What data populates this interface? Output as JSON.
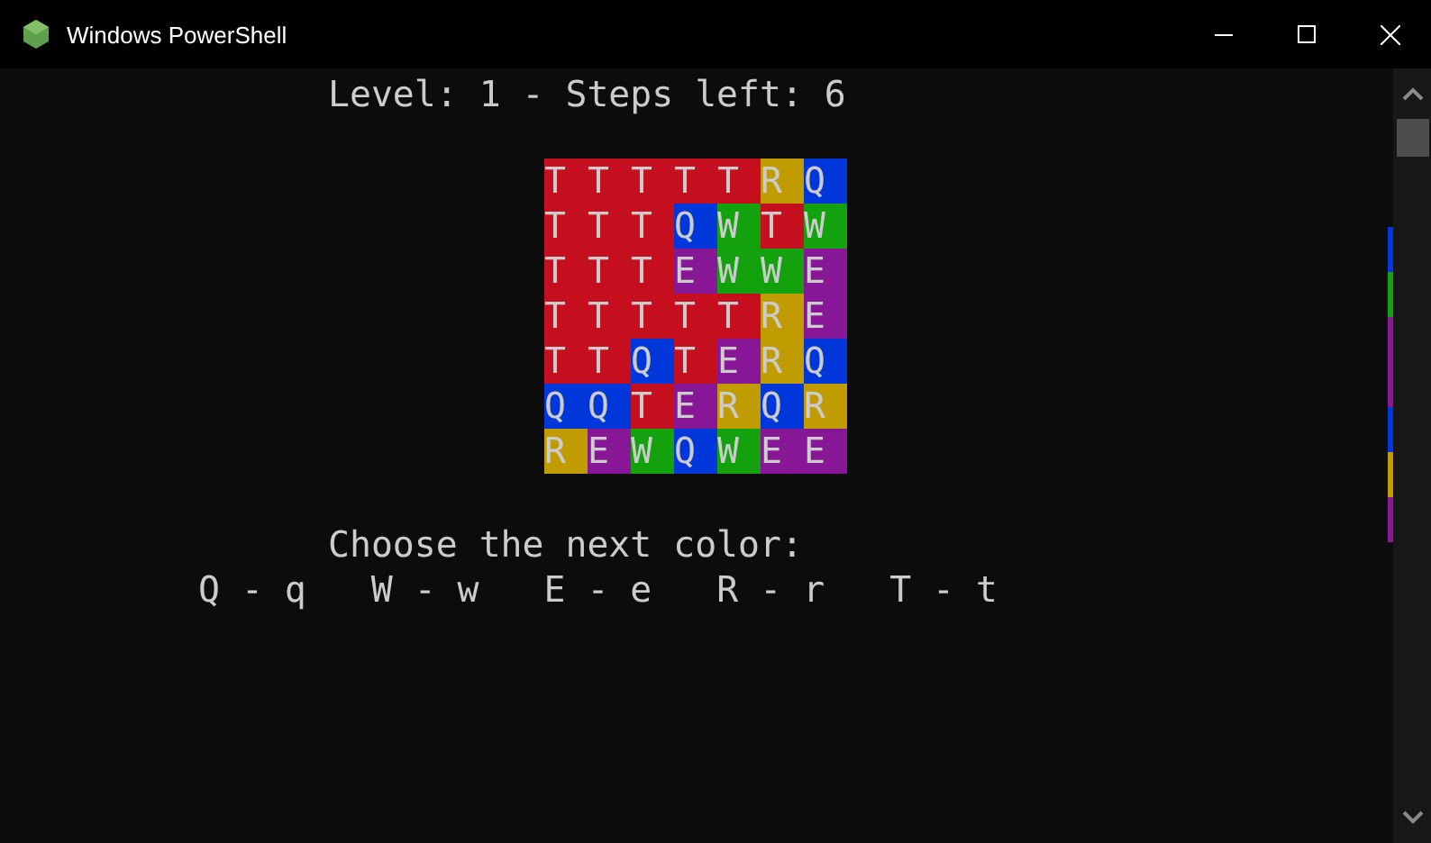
{
  "window": {
    "title": "Windows PowerShell"
  },
  "console": {
    "status": "Level: 1 - Steps left: 6",
    "grid": [
      [
        {
          "letter": "T",
          "color": "#c50f1f"
        },
        {
          "letter": "T",
          "color": "#c50f1f"
        },
        {
          "letter": "T",
          "color": "#c50f1f"
        },
        {
          "letter": "T",
          "color": "#c50f1f"
        },
        {
          "letter": "T",
          "color": "#c50f1f"
        },
        {
          "letter": "R",
          "color": "#c19c00"
        },
        {
          "letter": "Q",
          "color": "#0037da"
        }
      ],
      [
        {
          "letter": "T",
          "color": "#c50f1f"
        },
        {
          "letter": "T",
          "color": "#c50f1f"
        },
        {
          "letter": "T",
          "color": "#c50f1f"
        },
        {
          "letter": "Q",
          "color": "#0037da"
        },
        {
          "letter": "W",
          "color": "#13a10e"
        },
        {
          "letter": "T",
          "color": "#c50f1f"
        },
        {
          "letter": "W",
          "color": "#13a10e"
        }
      ],
      [
        {
          "letter": "T",
          "color": "#c50f1f"
        },
        {
          "letter": "T",
          "color": "#c50f1f"
        },
        {
          "letter": "T",
          "color": "#c50f1f"
        },
        {
          "letter": "E",
          "color": "#881798"
        },
        {
          "letter": "W",
          "color": "#13a10e"
        },
        {
          "letter": "W",
          "color": "#13a10e"
        },
        {
          "letter": "E",
          "color": "#881798"
        }
      ],
      [
        {
          "letter": "T",
          "color": "#c50f1f"
        },
        {
          "letter": "T",
          "color": "#c50f1f"
        },
        {
          "letter": "T",
          "color": "#c50f1f"
        },
        {
          "letter": "T",
          "color": "#c50f1f"
        },
        {
          "letter": "T",
          "color": "#c50f1f"
        },
        {
          "letter": "R",
          "color": "#c19c00"
        },
        {
          "letter": "E",
          "color": "#881798"
        }
      ],
      [
        {
          "letter": "T",
          "color": "#c50f1f"
        },
        {
          "letter": "T",
          "color": "#c50f1f"
        },
        {
          "letter": "Q",
          "color": "#0037da"
        },
        {
          "letter": "T",
          "color": "#c50f1f"
        },
        {
          "letter": "E",
          "color": "#881798"
        },
        {
          "letter": "R",
          "color": "#c19c00"
        },
        {
          "letter": "Q",
          "color": "#0037da"
        }
      ],
      [
        {
          "letter": "Q",
          "color": "#0037da"
        },
        {
          "letter": "Q",
          "color": "#0037da"
        },
        {
          "letter": "T",
          "color": "#c50f1f"
        },
        {
          "letter": "E",
          "color": "#881798"
        },
        {
          "letter": "R",
          "color": "#c19c00"
        },
        {
          "letter": "Q",
          "color": "#0037da"
        },
        {
          "letter": "R",
          "color": "#c19c00"
        }
      ],
      [
        {
          "letter": "R",
          "color": "#c19c00"
        },
        {
          "letter": "E",
          "color": "#881798"
        },
        {
          "letter": "W",
          "color": "#13a10e"
        },
        {
          "letter": "Q",
          "color": "#0037da"
        },
        {
          "letter": "W",
          "color": "#13a10e"
        },
        {
          "letter": "E",
          "color": "#881798"
        },
        {
          "letter": "E",
          "color": "#881798"
        }
      ]
    ],
    "prompt": "Choose the next color:",
    "options": [
      "Q - q",
      "W - w",
      "E - e",
      "R - r",
      "T - t"
    ]
  }
}
